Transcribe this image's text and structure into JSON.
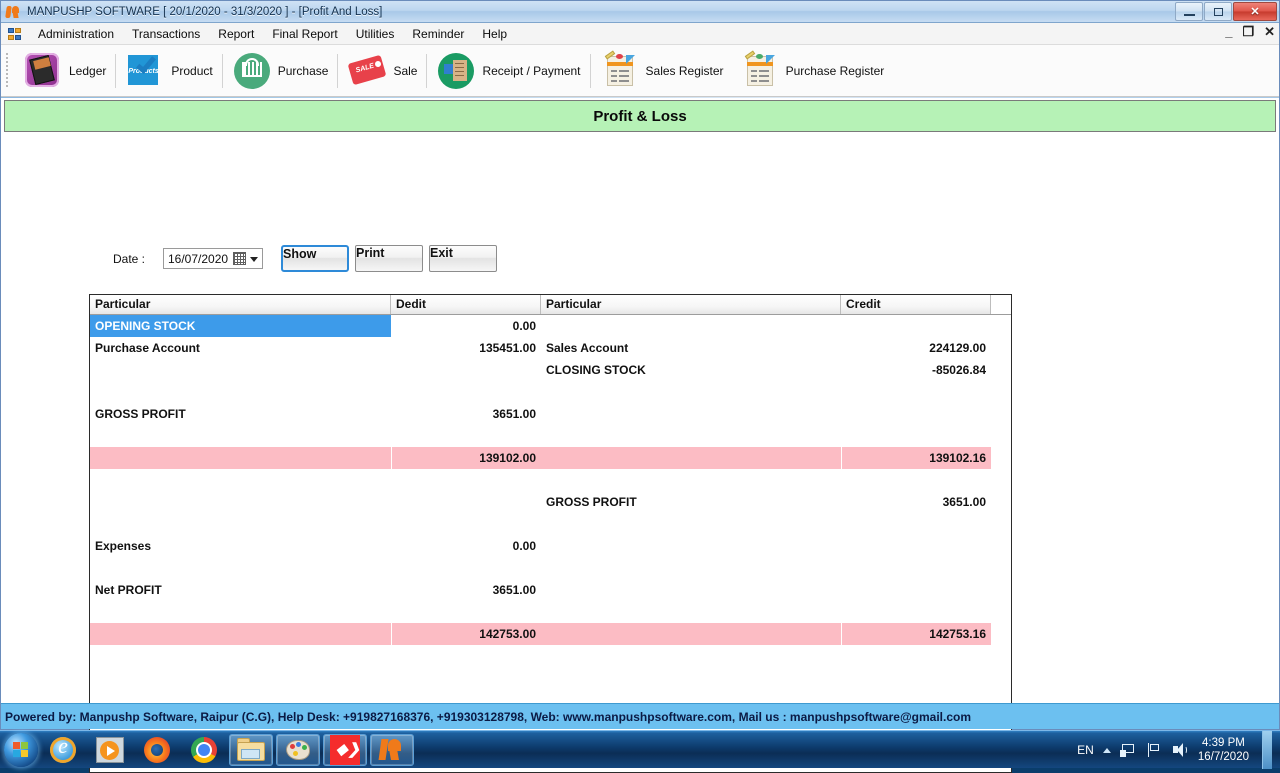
{
  "window": {
    "title": "MANPUSHP SOFTWARE [ 20/1/2020 - 31/3/2020 ]   - [Profit And Loss]",
    "minimize": "–",
    "maximize": "❐",
    "close": "✕"
  },
  "mdi_controls": {
    "minimize": "_",
    "restore": "❐",
    "close": "✕"
  },
  "menubar": {
    "items": [
      {
        "label": "Administration"
      },
      {
        "label": "Transactions"
      },
      {
        "label": "Report"
      },
      {
        "label": "Final Report"
      },
      {
        "label": "Utilities"
      },
      {
        "label": "Reminder"
      },
      {
        "label": "Help"
      }
    ]
  },
  "toolbar": {
    "items": [
      {
        "label": "Ledger",
        "icon": "ledger-icon"
      },
      {
        "label": "Product",
        "icon": "product-icon"
      },
      {
        "label": "Purchase",
        "icon": "purchase-basket-icon"
      },
      {
        "label": "Sale",
        "icon": "sale-tag-icon"
      },
      {
        "label": "Receipt / Payment",
        "icon": "receipt-payment-icon"
      },
      {
        "label": "Sales Register",
        "icon": "sales-register-icon"
      },
      {
        "label": "Purchase Register",
        "icon": "purchase-register-icon"
      }
    ]
  },
  "form": {
    "header_title": "Profit & Loss",
    "date_label": "Date :",
    "date_value": "16/07/2020",
    "buttons": {
      "show": "Show",
      "print": "Print",
      "exit": "Exit"
    }
  },
  "grid": {
    "columns": [
      "Particular",
      "Dedit",
      "Particular",
      "Credit"
    ],
    "rows": [
      {
        "style": "selected",
        "c1": "OPENING STOCK",
        "c2": "0.00",
        "c3": "",
        "c4": ""
      },
      {
        "style": "normal",
        "c1": "Purchase Account",
        "c2": "135451.00",
        "c3": "Sales Account",
        "c4": "224129.00"
      },
      {
        "style": "normal",
        "c1": "",
        "c2": "",
        "c3": "CLOSING STOCK",
        "c4": "-85026.84"
      },
      {
        "style": "spacer",
        "c1": "",
        "c2": "",
        "c3": "",
        "c4": ""
      },
      {
        "style": "normal",
        "c1": "GROSS PROFIT",
        "c2": "3651.00",
        "c3": "",
        "c4": ""
      },
      {
        "style": "spacer",
        "c1": "",
        "c2": "",
        "c3": "",
        "c4": ""
      },
      {
        "style": "total",
        "c1": "",
        "c2": "139102.00",
        "c3": "",
        "c4": "139102.16"
      },
      {
        "style": "spacer",
        "c1": "",
        "c2": "",
        "c3": "",
        "c4": ""
      },
      {
        "style": "normal",
        "c1": "",
        "c2": "",
        "c3": "GROSS PROFIT",
        "c4": "3651.00"
      },
      {
        "style": "spacer",
        "c1": "",
        "c2": "",
        "c3": "",
        "c4": ""
      },
      {
        "style": "normal",
        "c1": "Expenses",
        "c2": "0.00",
        "c3": "",
        "c4": ""
      },
      {
        "style": "spacer",
        "c1": "",
        "c2": "",
        "c3": "",
        "c4": ""
      },
      {
        "style": "normal",
        "c1": "Net PROFIT",
        "c2": "3651.00",
        "c3": "",
        "c4": ""
      },
      {
        "style": "spacer",
        "c1": "",
        "c2": "",
        "c3": "",
        "c4": ""
      },
      {
        "style": "total",
        "c1": "",
        "c2": "142753.00",
        "c3": "",
        "c4": "142753.16"
      }
    ]
  },
  "statusbar": {
    "text": "Powered by: Manpushp Software, Raipur (C.G), Help Desk: +919827168376, +919303128798, Web: www.manpushpsoftware.com,  Mail us :  manpushpsoftware@gmail.com"
  },
  "taskbar": {
    "start_label": "start-orb",
    "items": [
      {
        "name": "internet-explorer-icon",
        "framed": false
      },
      {
        "name": "windows-media-player-icon",
        "framed": false
      },
      {
        "name": "firefox-icon",
        "framed": false
      },
      {
        "name": "google-chrome-icon",
        "framed": false
      },
      {
        "name": "file-explorer-icon",
        "framed": true
      },
      {
        "name": "paint-icon",
        "framed": true
      },
      {
        "name": "red-app-icon",
        "framed": true
      },
      {
        "name": "manpushp-app-icon",
        "framed": true
      }
    ],
    "tray": {
      "language": "EN",
      "time": "4:39 PM",
      "date": "16/7/2020"
    }
  },
  "colors": {
    "form_header_green": "#b6f2b6",
    "selection_blue": "#3d9bea",
    "total_pink": "#fcbcc4",
    "statusbar_blue": "#6cc0f0"
  }
}
